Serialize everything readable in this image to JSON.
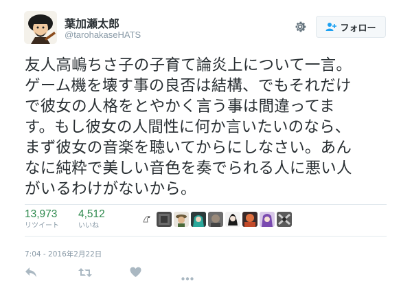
{
  "author": {
    "display_name": "葉加瀬太郎",
    "screen_name": "@tarohakaseHATS"
  },
  "header": {
    "settings_icon": "gear-icon",
    "follow_label": "フォロー",
    "follow_icon": "add-user-icon"
  },
  "tweet": {
    "lines": [
      "友人高嶋ちさ子の子育て論炎上について一言。",
      "ゲーム機を壊す事の良否は結構、でもそれだけ",
      "で彼女の人格をとやかく言う事は間違ってま",
      "す。もし彼女の人間性に何か言いたいのなら、",
      "まず彼女の音楽を聴いてからにしなさい。あん",
      "なに純粋で美しい音色を奏でられる人に悪い人",
      "がいるわけがないから。"
    ],
    "timestamp": "7:04 - 2016年2月22日"
  },
  "stats": {
    "retweets": {
      "count": "13,973",
      "label": "リツイート"
    },
    "likes": {
      "count": "4,512",
      "label": "いいね"
    }
  },
  "actions": {
    "reply_icon": "reply-icon",
    "retweet_icon": "retweet-icon",
    "like_icon": "heart-icon",
    "more_icon": "more-icon"
  },
  "colors": {
    "text": "#292f33",
    "muted": "#8899a6",
    "stat_count": "#2f8a4e",
    "divider": "#e1e8ed",
    "action_icon": "#aab8c2"
  }
}
